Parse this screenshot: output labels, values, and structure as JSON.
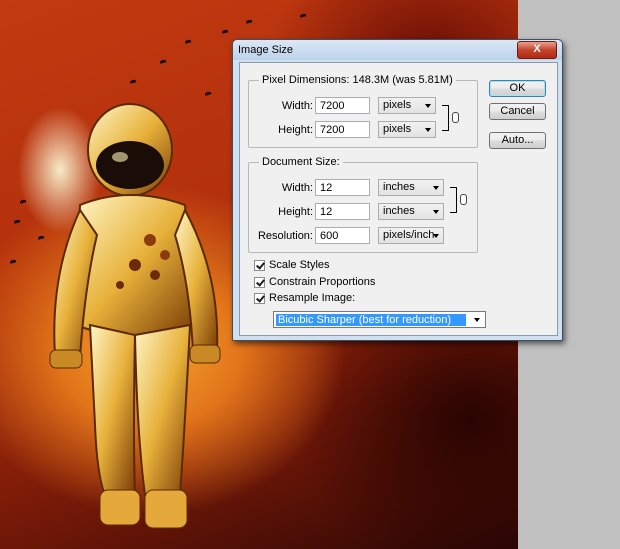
{
  "dialog": {
    "title": "Image Size",
    "close_label": "X",
    "pixel_dimensions": {
      "label": "Pixel Dimensions:",
      "summary": "148.3M (was 5.81M)",
      "width_label": "Width:",
      "width_value": "7200",
      "width_unit": "pixels",
      "height_label": "Height:",
      "height_value": "7200",
      "height_unit": "pixels"
    },
    "document_size": {
      "label": "Document Size:",
      "width_label": "Width:",
      "width_value": "12",
      "width_unit": "inches",
      "height_label": "Height:",
      "height_value": "12",
      "height_unit": "inches",
      "resolution_label": "Resolution:",
      "resolution_value": "600",
      "resolution_unit": "pixels/inch"
    },
    "options": {
      "scale_styles": {
        "label": "Scale Styles",
        "checked": true
      },
      "constrain_proportions": {
        "label": "Constrain Proportions",
        "checked": true
      },
      "resample_image": {
        "label": "Resample Image:",
        "checked": true
      },
      "resample_method": "Bicubic Sharper (best for reduction)"
    },
    "buttons": {
      "ok": "OK",
      "cancel": "Cancel",
      "auto": "Auto..."
    }
  },
  "colors": {
    "title_bar": "#c8dbef",
    "close_button": "#c4432b",
    "selection": "#3399ff",
    "dialog_face": "#f0f0f0"
  },
  "icons": [
    "close-icon",
    "chain-link-icon",
    "dropdown-arrow-icon",
    "checkbox-check-icon"
  ]
}
